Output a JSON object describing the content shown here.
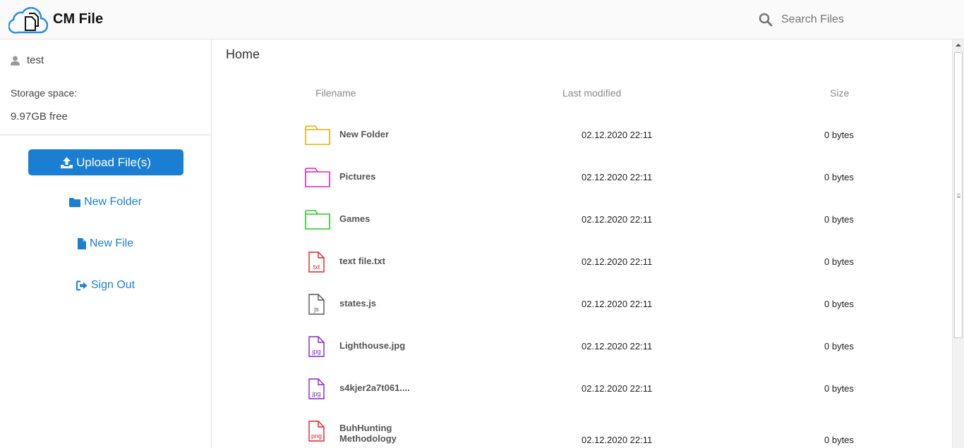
{
  "header": {
    "app_title": "CM File",
    "search_placeholder": "Search Files"
  },
  "sidebar": {
    "username": "test",
    "storage_label": "Storage space:",
    "storage_free": "9.97GB free",
    "upload_label": "Upload File(s)",
    "new_folder_label": "New Folder",
    "new_file_label": "New File",
    "sign_out_label": "Sign Out"
  },
  "main": {
    "breadcrumb": "Home",
    "columns": {
      "filename": "Filename",
      "modified": "Last modified",
      "size": "Size"
    },
    "rows": [
      {
        "name": "New Folder",
        "modified": "02.12.2020 22:11",
        "size": "0 bytes",
        "icon": "folder-icon",
        "color": "#e0b000",
        "ext": ""
      },
      {
        "name": "Pictures",
        "modified": "02.12.2020 22:11",
        "size": "0 bytes",
        "icon": "folder-icon",
        "color": "#e020c0",
        "ext": ""
      },
      {
        "name": "Games",
        "modified": "02.12.2020 22:11",
        "size": "0 bytes",
        "icon": "folder-icon",
        "color": "#22cc22",
        "ext": ""
      },
      {
        "name": "text file.txt",
        "modified": "02.12.2020 22:11",
        "size": "0 bytes",
        "icon": "file-icon",
        "color": "#e02020",
        "ext": "txt"
      },
      {
        "name": "states.js",
        "modified": "02.12.2020 22:11",
        "size": "0 bytes",
        "icon": "file-icon",
        "color": "#555555",
        "ext": "js"
      },
      {
        "name": "Lighthouse.jpg",
        "modified": "02.12.2020 22:11",
        "size": "0 bytes",
        "icon": "file-icon",
        "color": "#8a20c8",
        "ext": "jpg"
      },
      {
        "name": "s4kjer2a7t061....",
        "modified": "02.12.2020 22:11",
        "size": "0 bytes",
        "icon": "file-icon",
        "color": "#8a20c8",
        "ext": "jpg"
      },
      {
        "name": "BuhHunting Methodology",
        "name_line1": "BuhHunting",
        "name_line2": "Methodology",
        "modified": "02.12.2020 22:11",
        "size": "0 bytes",
        "icon": "file-icon",
        "color": "#e02020",
        "ext": "png"
      }
    ]
  },
  "colors": {
    "accent": "#1a7fd2",
    "header_bg": "#fafafa"
  }
}
